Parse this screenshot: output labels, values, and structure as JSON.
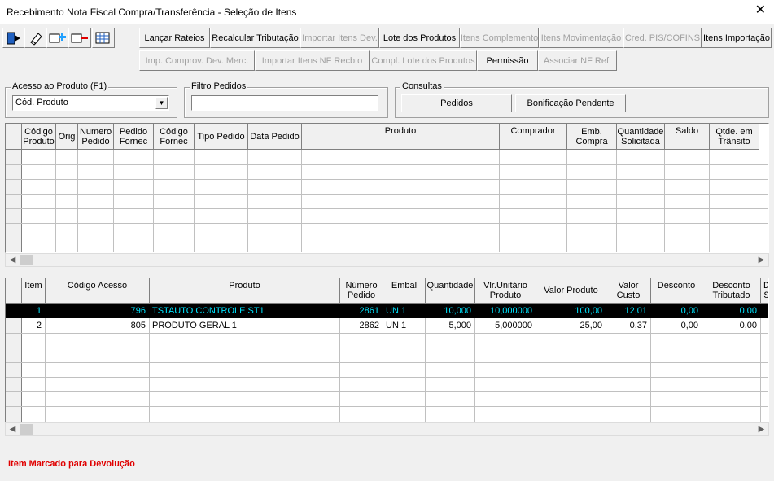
{
  "window": {
    "title": "Recebimento Nota Fiscal Compra/Transferência - Seleção de Itens",
    "close": "✕"
  },
  "toolbar_icons": [
    "exit-icon",
    "eraser-icon",
    "add-item-icon",
    "remove-item-icon",
    "grid-icon"
  ],
  "buttons_row1": [
    {
      "label": "Lançar Rateios",
      "enabled": true
    },
    {
      "label": "Recalcular Tributação",
      "enabled": true
    },
    {
      "label": "Importar Itens Dev.",
      "enabled": false
    },
    {
      "label": "Lote dos Produtos",
      "enabled": true
    },
    {
      "label": "Itens Complemento",
      "enabled": false
    },
    {
      "label": "Itens Movimentação",
      "enabled": false
    },
    {
      "label": "Cred. PIS/COFINS",
      "enabled": false
    },
    {
      "label": "Itens Importação",
      "enabled": true
    }
  ],
  "buttons_row2": [
    {
      "label": "Imp. Comprov. Dev. Merc.",
      "enabled": false
    },
    {
      "label": "Importar Itens NF Recbto",
      "enabled": false
    },
    {
      "label": "Compl. Lote dos Produtos",
      "enabled": false
    },
    {
      "label": "Permissão",
      "enabled": true
    },
    {
      "label": "Associar NF Ref.",
      "enabled": false
    }
  ],
  "acesso": {
    "legend": "Acesso ao Produto (F1)",
    "selected": "Cód. Produto"
  },
  "filtro": {
    "legend": "Filtro Pedidos",
    "value": ""
  },
  "consultas": {
    "legend": "Consultas",
    "pedidos": "Pedidos",
    "bonificacao": "Bonificação Pendente"
  },
  "grid1": {
    "columns": [
      "Código Produto",
      "Orig",
      "Numero Pedido",
      "Pedido Fornec",
      "Código Fornec",
      "Tipo Pedido",
      "Data Pedido",
      "Produto",
      "Comprador",
      "Emb. Compra",
      "Quantidade Solicitada",
      "Saldo",
      "Qtde. em Trânsito"
    ]
  },
  "grid2": {
    "columns": [
      "Item",
      "Código Acesso",
      "Produto",
      "Número Pedido",
      "Embal",
      "Quantidade",
      "Vlr.Unitário Produto",
      "Valor Produto",
      "Valor Custo",
      "Desconto",
      "Desconto Tributado",
      "D S"
    ],
    "rows": [
      {
        "item": "1",
        "codigo": "796",
        "produto": "TSTAUTO CONTROLE ST1",
        "pedido": "2861",
        "embal": "UN  1",
        "quantidade": "10,000",
        "vlr_unit": "10,000000",
        "valor": "100,00",
        "custo": "12,01",
        "desconto": "0,00",
        "desc_trib": "0,00",
        "selected": true
      },
      {
        "item": "2",
        "codigo": "805",
        "produto": "PRODUTO GERAL 1",
        "pedido": "2862",
        "embal": "UN  1",
        "quantidade": "5,000",
        "vlr_unit": "5,000000",
        "valor": "25,00",
        "custo": "0,37",
        "desconto": "0,00",
        "desc_trib": "0,00",
        "selected": false
      }
    ]
  },
  "status_text": "Item Marcado para Devolução"
}
